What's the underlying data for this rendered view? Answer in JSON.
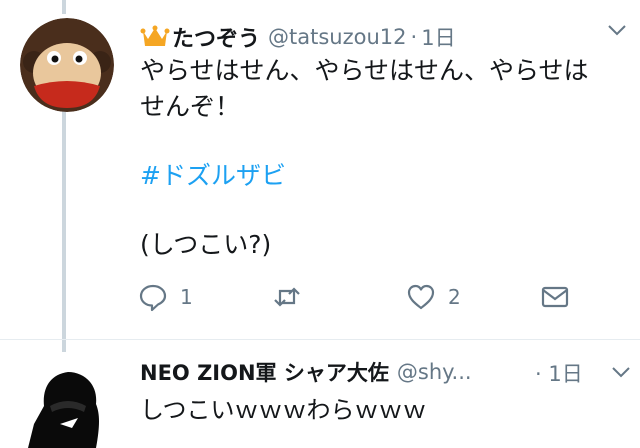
{
  "tweet1": {
    "display_name": "たつぞう",
    "handle": "@tatsuzou12",
    "separator": "·",
    "time": "1日",
    "line1": "やらせはせん、やらせはせん、やらせは",
    "line2": "せんぞ！",
    "hashtag": "#ドズルザビ",
    "line4": "(しつこい?)",
    "reply_count": "1",
    "like_count": "2",
    "icons": [
      "crown-icon",
      "reply-icon",
      "retweet-icon",
      "like-icon",
      "message-icon",
      "chevron-down-icon"
    ]
  },
  "tweet2": {
    "display_name": "NEO ZION軍 シャア大佐",
    "handle": "@shy...",
    "time": "· 1日",
    "text": "しつこいｗｗｗわらｗｗｗ"
  },
  "colors": {
    "hashtag": "#1da1f2",
    "secondary_text": "#657786",
    "crown": "#f5a623",
    "thread_line": "#ccd6dd"
  }
}
